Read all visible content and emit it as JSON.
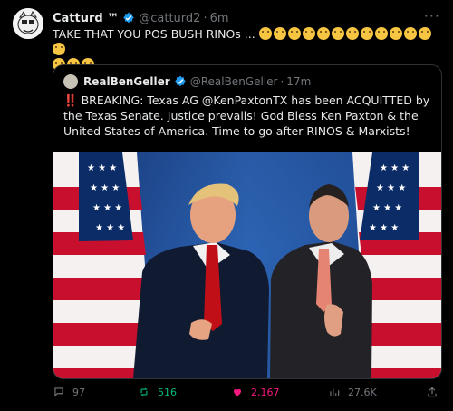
{
  "tweet": {
    "author_name": "Catturd ™",
    "author_handle": "@catturd2",
    "time": "6m",
    "text": "TAKE THAT YOU POS BUSH RINOs ...",
    "emoji_name": "laughing-face",
    "emoji_count_line1": 13,
    "emoji_count_line2": 3
  },
  "quote": {
    "author_name": "RealBenGeller",
    "author_handle": "@RealBenGeller",
    "time": "17m",
    "alert_emoji": "‼️",
    "text": "BREAKING: Texas AG @KenPaxtonTX has been ACQUITTED by the Texas Senate. Justice prevails! God Bless Ken Paxton & the United States of America. Time to go after RINOS & Marxists!"
  },
  "actions": {
    "replies": "97",
    "retweets": "516",
    "likes": "2,167",
    "views": "27.6K"
  },
  "colors": {
    "background": "#000000",
    "text": "#e7e9ea",
    "muted": "#71767b",
    "verified": "#1d9bf0",
    "retweet": "#00ba7c",
    "like": "#f91880",
    "stage": "#1f4c95"
  }
}
